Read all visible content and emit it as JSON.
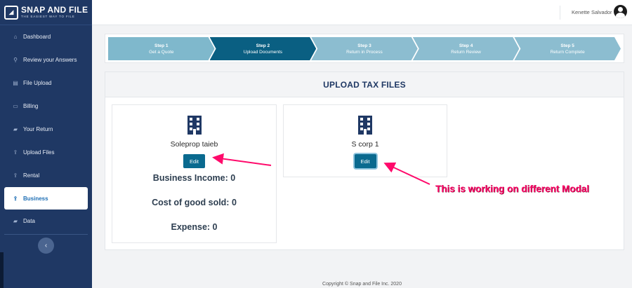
{
  "brand": {
    "name": "SNAP AND FILE",
    "tagline": "THE EASIEST WAY TO FILE"
  },
  "sidebar": {
    "items": [
      {
        "label": "Dashboard",
        "icon": "home-icon"
      },
      {
        "label": "Review your Answers",
        "icon": "search-icon"
      },
      {
        "label": "File Upload",
        "icon": "file-icon"
      },
      {
        "label": "Billing",
        "icon": "credit-card-icon"
      },
      {
        "label": "Your Return",
        "icon": "folder-icon"
      },
      {
        "label": "Upload Files",
        "icon": "upload-icon"
      },
      {
        "label": "Rental",
        "icon": "upload-icon"
      },
      {
        "label": "Business",
        "icon": "upload-icon"
      },
      {
        "label": "Data",
        "icon": "folder-icon"
      }
    ],
    "active_index": 7,
    "collapse_icon": "chevron-left-icon"
  },
  "header": {
    "user_name": "Kenette Salvador",
    "avatar_icon": "user-avatar-icon"
  },
  "stepper": [
    {
      "title": "Step 1",
      "label": "Get a Quote"
    },
    {
      "title": "Step 2",
      "label": "Upload Documents"
    },
    {
      "title": "Step 3",
      "label": "Return in Process"
    },
    {
      "title": "Step 4",
      "label": "Return Review"
    },
    {
      "title": "Step 5",
      "label": "Return Complete"
    }
  ],
  "panel": {
    "title": "UPLOAD TAX FILES",
    "cards": [
      {
        "name": "Soleprop taieb",
        "button": "Edit",
        "metrics": [
          "Business Income: 0",
          "Cost of good sold: 0",
          "Expense: 0"
        ]
      },
      {
        "name": "S corp 1",
        "button": "Edit"
      }
    ]
  },
  "annotation": {
    "text": "This is working on different Modal",
    "color": "#ff0a6b"
  },
  "footer": {
    "text": "Copyright © Snap and File Inc. 2020"
  },
  "colors": {
    "sidebar": "#1f3864",
    "primary": "#0a6a8f",
    "step_active": "#0a5f82",
    "step_inactive": "#8cbdd0"
  }
}
